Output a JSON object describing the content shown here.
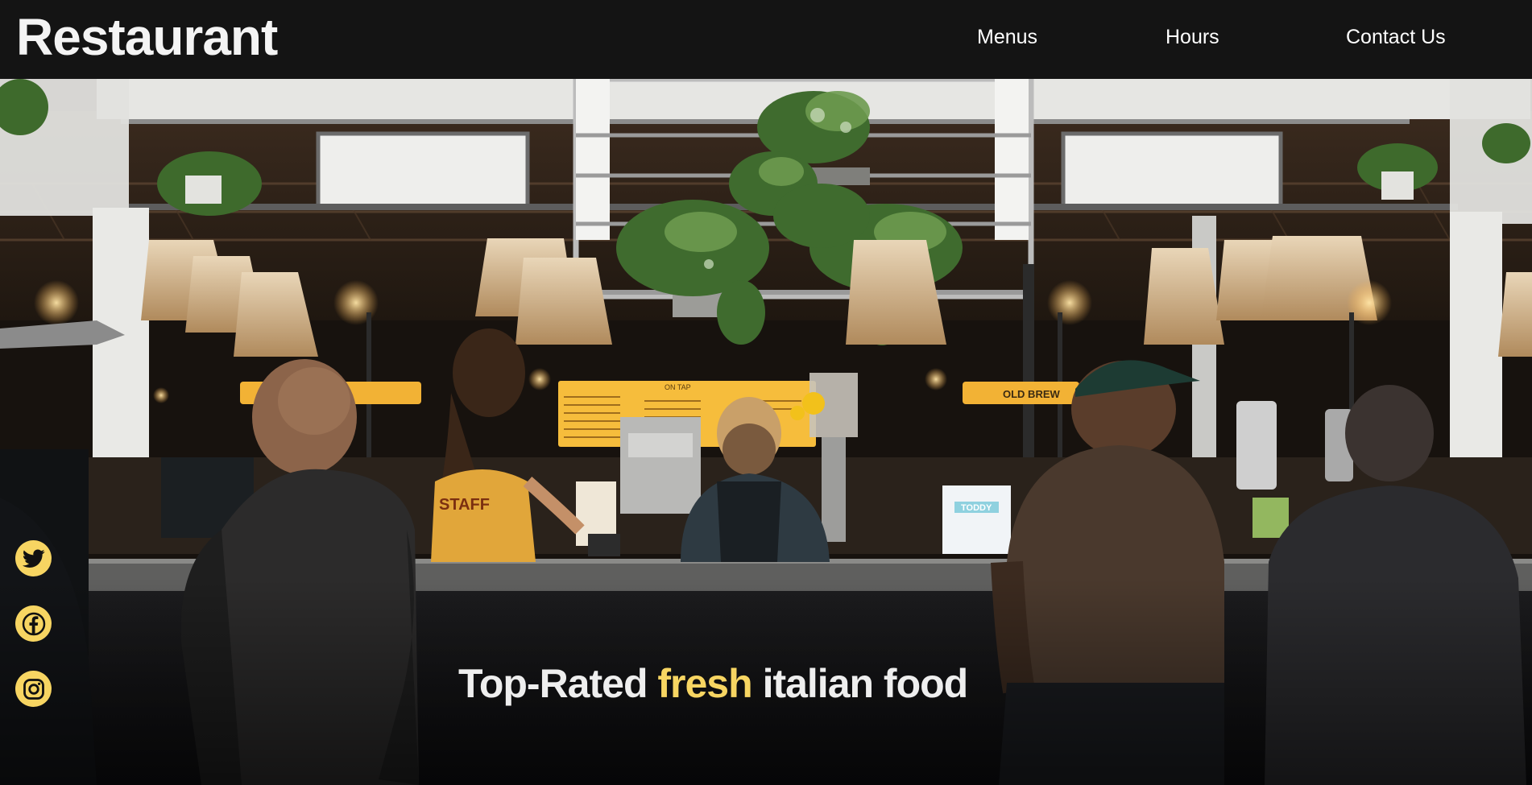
{
  "header": {
    "brand": "Restaurant",
    "nav": [
      {
        "label": "Menus"
      },
      {
        "label": "Hours"
      },
      {
        "label": "Contact Us"
      }
    ]
  },
  "hero": {
    "tagline": {
      "before": "Top-Rated",
      "highlight": "fresh",
      "after": "italian food"
    },
    "menu_board_label": "ON TAP",
    "staff_shirt_text": "STAFF",
    "container_label": "TODDY",
    "cold_brew_sign": "OLD BREW"
  },
  "social": [
    {
      "icon": "twitter-icon"
    },
    {
      "icon": "facebook-icon"
    },
    {
      "icon": "instagram-icon"
    }
  ],
  "colors": {
    "header_bg": "#141414",
    "accent": "#f7d562",
    "text": "#eeeeee"
  }
}
